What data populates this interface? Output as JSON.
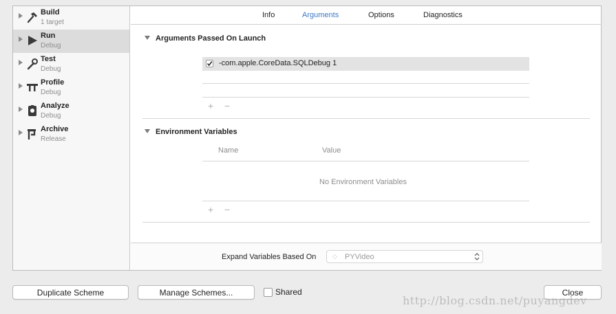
{
  "sidebar": {
    "items": [
      {
        "name": "Build",
        "sub": "1 target",
        "icon": "hammer-icon"
      },
      {
        "name": "Run",
        "sub": "Debug",
        "icon": "play-icon",
        "selected": true
      },
      {
        "name": "Test",
        "sub": "Debug",
        "icon": "wrench-icon"
      },
      {
        "name": "Profile",
        "sub": "Debug",
        "icon": "instruments-icon"
      },
      {
        "name": "Analyze",
        "sub": "Debug",
        "icon": "analyze-icon"
      },
      {
        "name": "Archive",
        "sub": "Release",
        "icon": "archive-icon"
      }
    ]
  },
  "tabs": [
    {
      "label": "Info"
    },
    {
      "label": "Arguments",
      "active": true
    },
    {
      "label": "Options"
    },
    {
      "label": "Diagnostics"
    }
  ],
  "arguments": {
    "title": "Arguments Passed On Launch",
    "items": [
      {
        "checked": true,
        "value": "-com.apple.CoreData.SQLDebug 1"
      }
    ],
    "add": "+",
    "remove": "−"
  },
  "environment": {
    "title": "Environment Variables",
    "col_name": "Name",
    "col_value": "Value",
    "empty": "No Environment Variables",
    "add": "+",
    "remove": "−"
  },
  "expand": {
    "label": "Expand Variables Based On",
    "value": "PYVideo"
  },
  "footer": {
    "duplicate": "Duplicate Scheme",
    "manage": "Manage Schemes...",
    "shared": "Shared",
    "close": "Close"
  },
  "watermark": "http://blog.csdn.net/puyangdev",
  "colors": {
    "accent": "#3c79c8",
    "selected_row": "#dcdcdc"
  }
}
